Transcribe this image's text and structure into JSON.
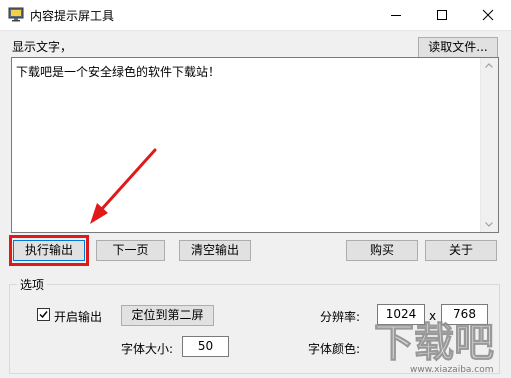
{
  "window": {
    "title": "内容提示屏工具",
    "icon": "app-monitor-icon",
    "controls": [
      "minimize-icon",
      "maximize-icon",
      "close-icon"
    ]
  },
  "display": {
    "label": "显示文字，",
    "read_file_label": "读取文件...",
    "text": "下载吧是一个安全绿色的软件下载站！"
  },
  "buttons": {
    "execute": "执行输出",
    "next_page": "下一页",
    "clear": "清空输出",
    "buy": "购买",
    "about": "关于"
  },
  "options": {
    "group_label": "选项",
    "enable_output_label": "开启输出",
    "enable_output_checked": true,
    "locate_second_screen": "定位到第二屏",
    "font_size_label": "字体大小:",
    "font_size_value": "50",
    "resolution_label": "分辨率:",
    "resolution_width": "1024",
    "resolution_sep": "x",
    "resolution_height": "768",
    "font_color_label": "字体颜色:"
  },
  "annotation": {
    "highlight_color": "#e01a1a"
  },
  "watermark": {
    "text": "下载吧",
    "url": "www.xiazaiba.com"
  }
}
